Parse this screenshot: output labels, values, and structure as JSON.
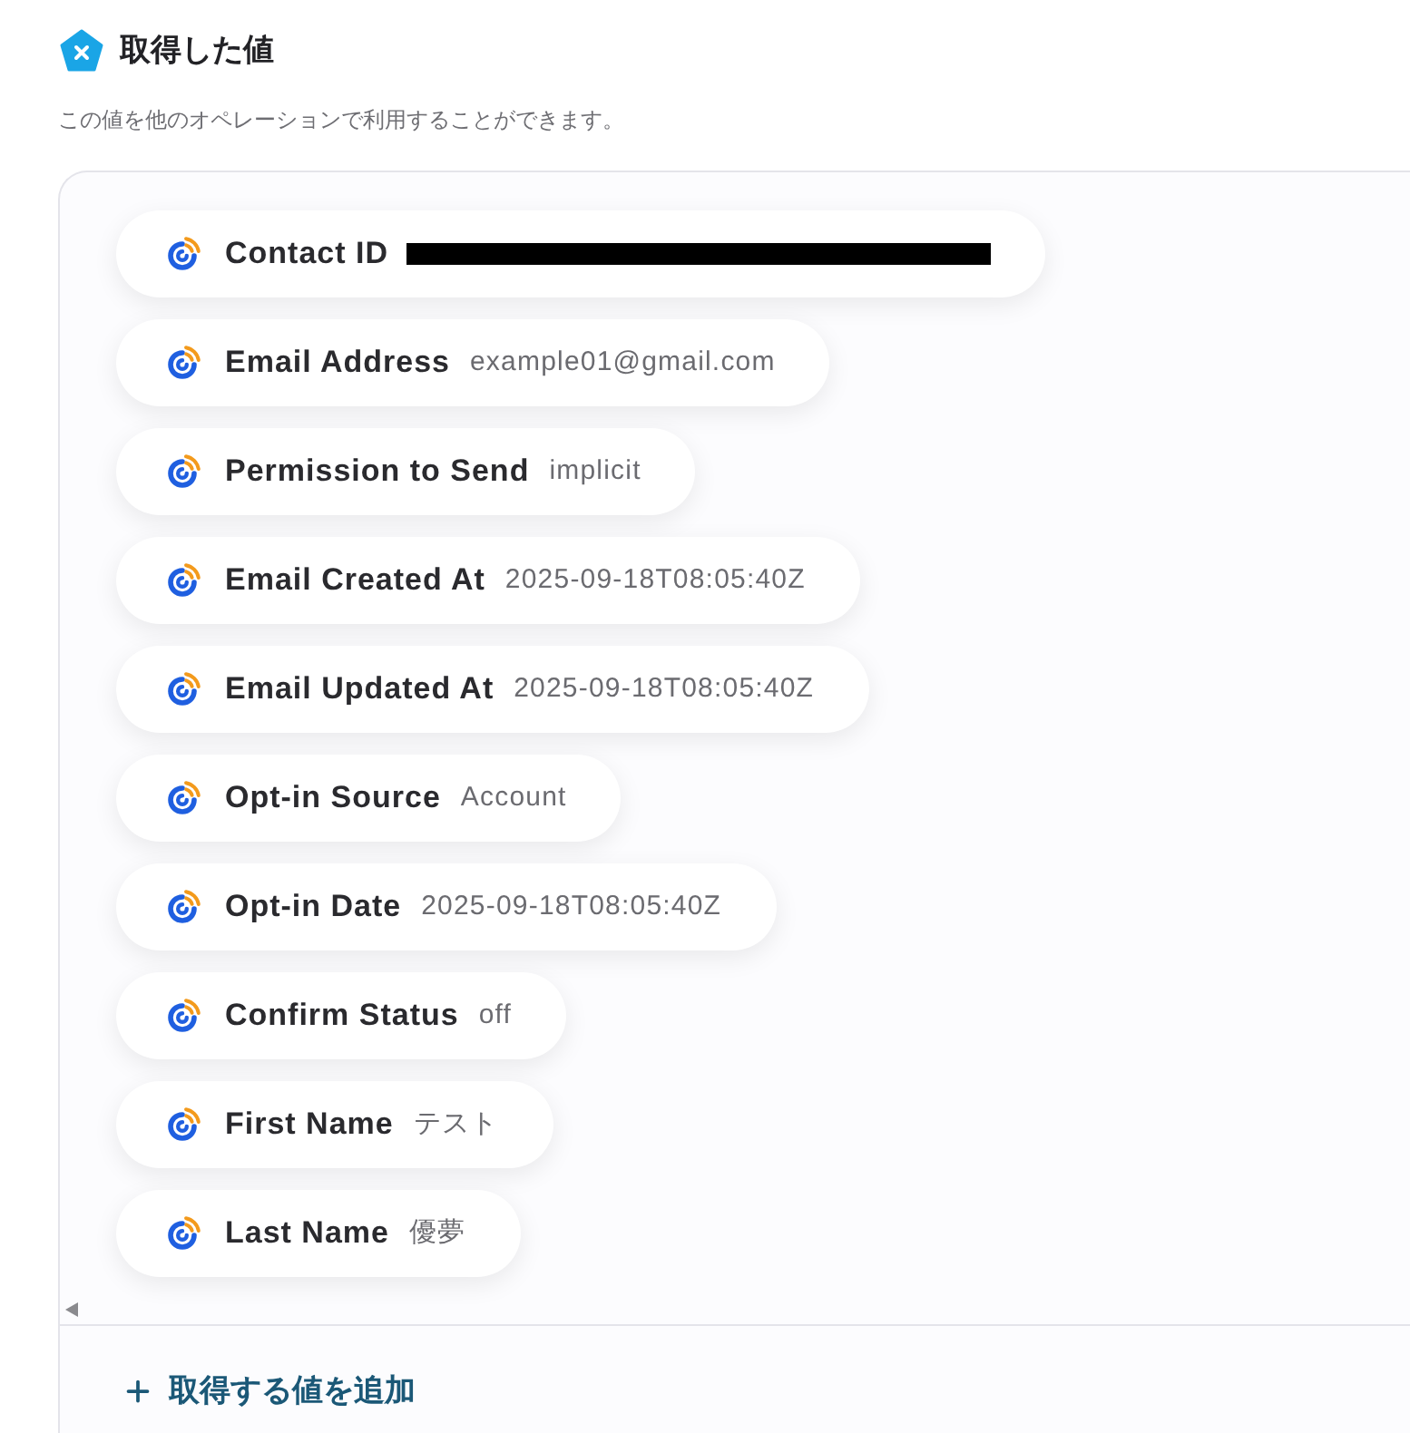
{
  "header": {
    "title": "取得した値",
    "description": "この値を他のオペレーションで利用することができます。"
  },
  "fields": [
    {
      "label": "Contact ID",
      "redacted": true
    },
    {
      "label": "Email Address",
      "value": "example01@gmail.com",
      "redacted": false
    },
    {
      "label": "Permission to Send",
      "value": "implicit",
      "redacted": false
    },
    {
      "label": "Email Created At",
      "value": "2025-09-18T08:05:40Z",
      "redacted": false
    },
    {
      "label": "Email Updated At",
      "value": "2025-09-18T08:05:40Z",
      "redacted": false
    },
    {
      "label": "Opt-in Source",
      "value": "Account",
      "redacted": false
    },
    {
      "label": "Opt-in Date",
      "value": "2025-09-18T08:05:40Z",
      "redacted": false
    },
    {
      "label": "Confirm Status",
      "value": "off",
      "redacted": false
    },
    {
      "label": "First Name",
      "value": "テスト",
      "redacted": false
    },
    {
      "label": "Last Name",
      "value": "優夢",
      "redacted": false
    }
  ],
  "add_button": {
    "label": "取得する値を追加"
  }
}
